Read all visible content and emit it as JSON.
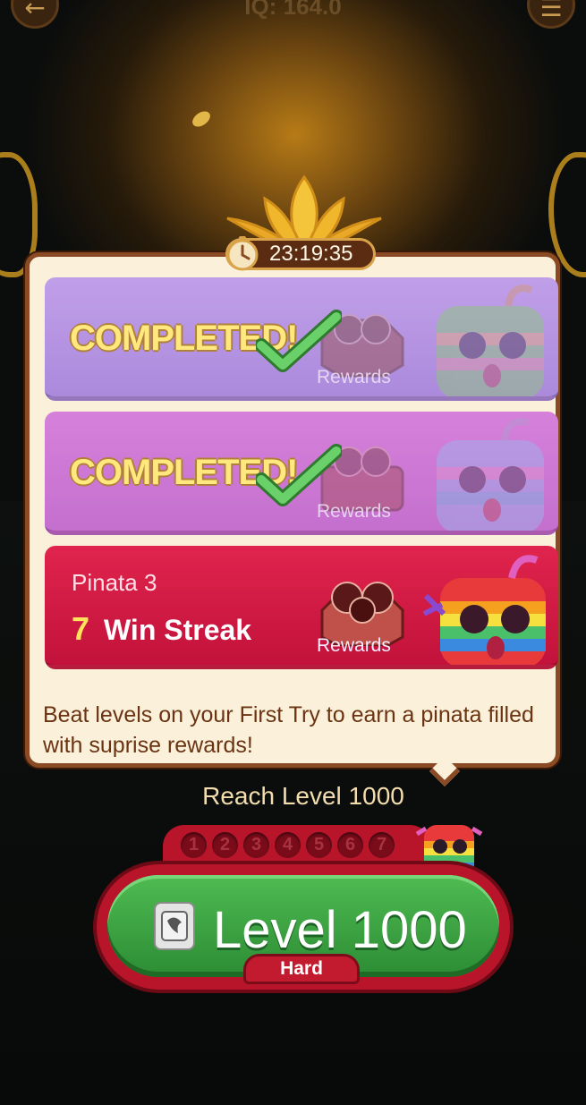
{
  "header": {
    "back_icon": "back-arrow-icon",
    "iq_label": "IQ: 164.0",
    "menu_icon": "menu-icon"
  },
  "event": {
    "timer": "23:19:35",
    "timer_icon": "stopwatch-icon",
    "tiers": [
      {
        "status": "COMPLETED!",
        "rewards_label": "Rewards",
        "completed": true,
        "color": "#a07ad8"
      },
      {
        "status": "COMPLETED!",
        "rewards_label": "Rewards",
        "completed": true,
        "color": "#bd5cc8"
      },
      {
        "name": "Pinata 3",
        "streak_count": "7",
        "streak_label": "Win Streak",
        "rewards_label": "Rewards",
        "completed": false,
        "color": "#c2123b"
      }
    ],
    "description": "Beat levels on your First Try to earn a pinata filled with suprise rewards!"
  },
  "progress": {
    "goal": "Reach Level 1000",
    "steps": [
      "1",
      "2",
      "3",
      "4",
      "5",
      "6",
      "7"
    ]
  },
  "play_button": {
    "label": "Level 1000",
    "difficulty": "Hard",
    "icon": "level-tile-icon",
    "color": "#2f9a38"
  }
}
